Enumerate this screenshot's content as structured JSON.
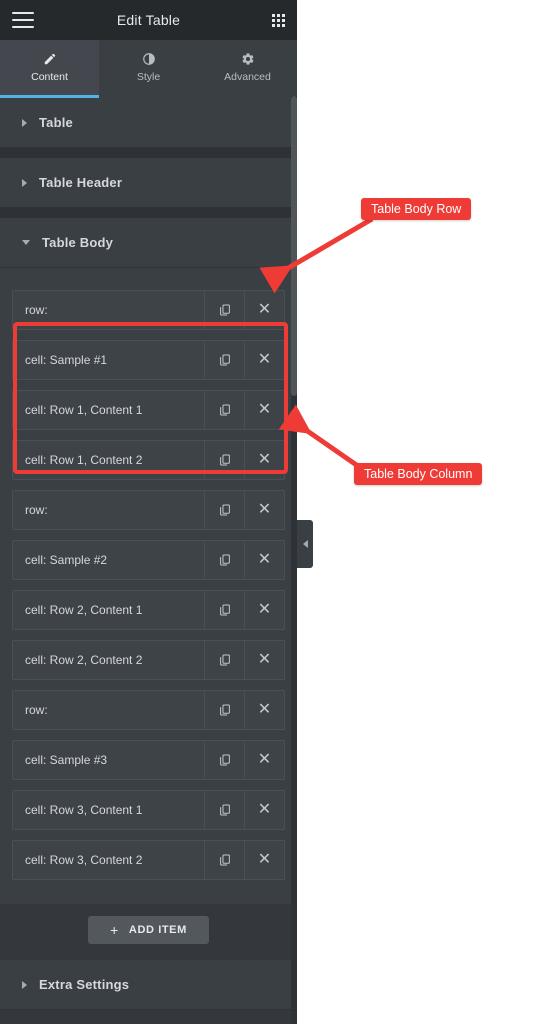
{
  "panel": {
    "header": {
      "menu_icon": "hamburger-icon",
      "title": "Edit Table",
      "apps_icon": "grid-apps-icon"
    },
    "tabs": [
      {
        "label": "Content",
        "icon": "pencil-icon",
        "active": true
      },
      {
        "label": "Style",
        "icon": "contrast-icon",
        "active": false
      },
      {
        "label": "Advanced",
        "icon": "gear-icon",
        "active": false
      }
    ],
    "sections": [
      {
        "label": "Table",
        "expanded": false
      },
      {
        "label": "Table Header",
        "expanded": false
      },
      {
        "label": "Table Body",
        "expanded": true
      },
      {
        "label": "Extra Settings",
        "expanded": false
      }
    ],
    "repeater_items": [
      {
        "label": "row:"
      },
      {
        "label": "cell: Sample #1"
      },
      {
        "label": "cell: Row 1, Content 1"
      },
      {
        "label": "cell: Row 1, Content 2"
      },
      {
        "label": "row:"
      },
      {
        "label": "cell: Sample #2"
      },
      {
        "label": "cell: Row 2, Content 1"
      },
      {
        "label": "cell: Row 2, Content 2"
      },
      {
        "label": "row:"
      },
      {
        "label": "cell: Sample #3"
      },
      {
        "label": "cell: Row 3, Content 1"
      },
      {
        "label": "cell: Row 3, Content 2"
      }
    ],
    "item_actions": {
      "duplicate_icon": "duplicate-icon",
      "remove_icon": "close-x-icon"
    },
    "add_item": {
      "plus": "+",
      "label": "ADD ITEM"
    },
    "collapse_handle_icon": "chevron-left-icon"
  },
  "annotations": [
    {
      "id": "row",
      "label": "Table Body Row"
    },
    {
      "id": "col",
      "label": "Table Body Column"
    }
  ],
  "colors": {
    "accent": "#51b4e5",
    "annotation": "#ef3b36",
    "panel_bg": "#34383c",
    "section_bg": "#3a3f44",
    "header_bg": "#26292c"
  }
}
